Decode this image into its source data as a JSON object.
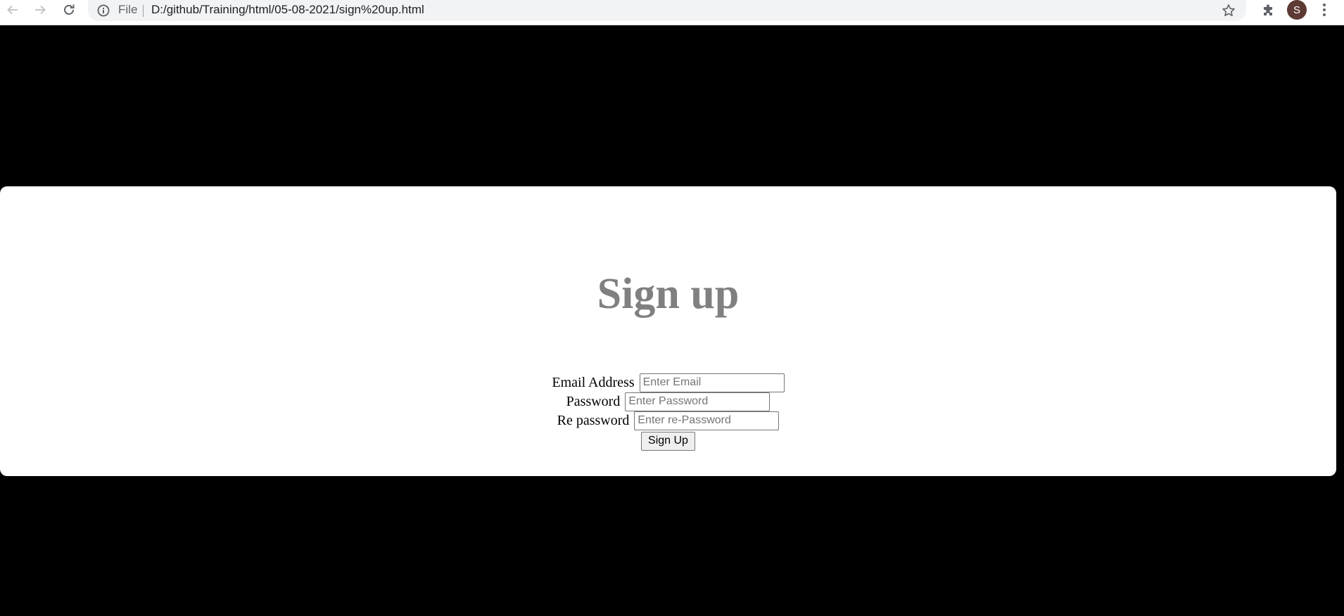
{
  "browser": {
    "scheme_label": "File",
    "url": "D:/github/Training/html/05-08-2021/sign%20up.html",
    "avatar_letter": "S",
    "icons": {
      "back": "arrow-left-icon",
      "forward": "arrow-right-icon",
      "reload": "reload-icon",
      "info": "info-icon",
      "bookmark": "star-icon",
      "extensions": "puzzle-icon",
      "menu": "kebab-menu-icon"
    }
  },
  "page": {
    "background_color": "#000000",
    "card_color": "#ffffff",
    "heading": "Sign up",
    "heading_color": "#808080",
    "form": {
      "email": {
        "label": "Email Address",
        "placeholder": "Enter Email",
        "value": ""
      },
      "password": {
        "label": "Password",
        "placeholder": "Enter Password",
        "value": ""
      },
      "repassword": {
        "label": "Re password",
        "placeholder": "Enter re-Password",
        "value": ""
      },
      "submit_label": "Sign Up"
    }
  }
}
